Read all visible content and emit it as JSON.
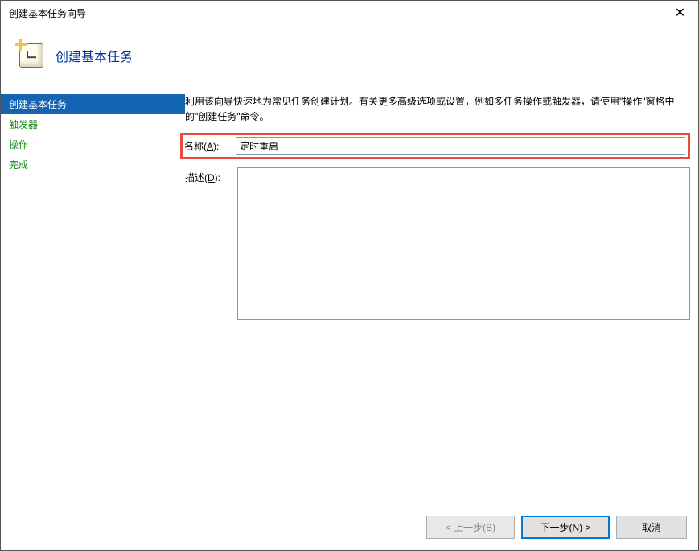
{
  "window": {
    "title": "创建基本任务向导"
  },
  "header": {
    "title": "创建基本任务"
  },
  "sidebar": {
    "items": [
      {
        "label": "创建基本任务",
        "active": true
      },
      {
        "label": "触发器",
        "active": false
      },
      {
        "label": "操作",
        "active": false
      },
      {
        "label": "完成",
        "active": false
      }
    ]
  },
  "main": {
    "intro": "利用该向导快速地为常见任务创建计划。有关更多高级选项或设置，例如多任务操作或触发器，请使用\"操作\"窗格中的\"创建任务\"命令。",
    "name_label_pre": "名称(",
    "name_label_key": "A",
    "name_label_post": "):",
    "name_value": "定时重启",
    "desc_label_pre": "描述(",
    "desc_label_key": "D",
    "desc_label_post": "):",
    "desc_value": ""
  },
  "footer": {
    "back_pre": "< 上一步(",
    "back_key": "B",
    "back_post": ")",
    "next_pre": "下一步(",
    "next_key": "N",
    "next_post": ") >",
    "cancel": "取消"
  }
}
